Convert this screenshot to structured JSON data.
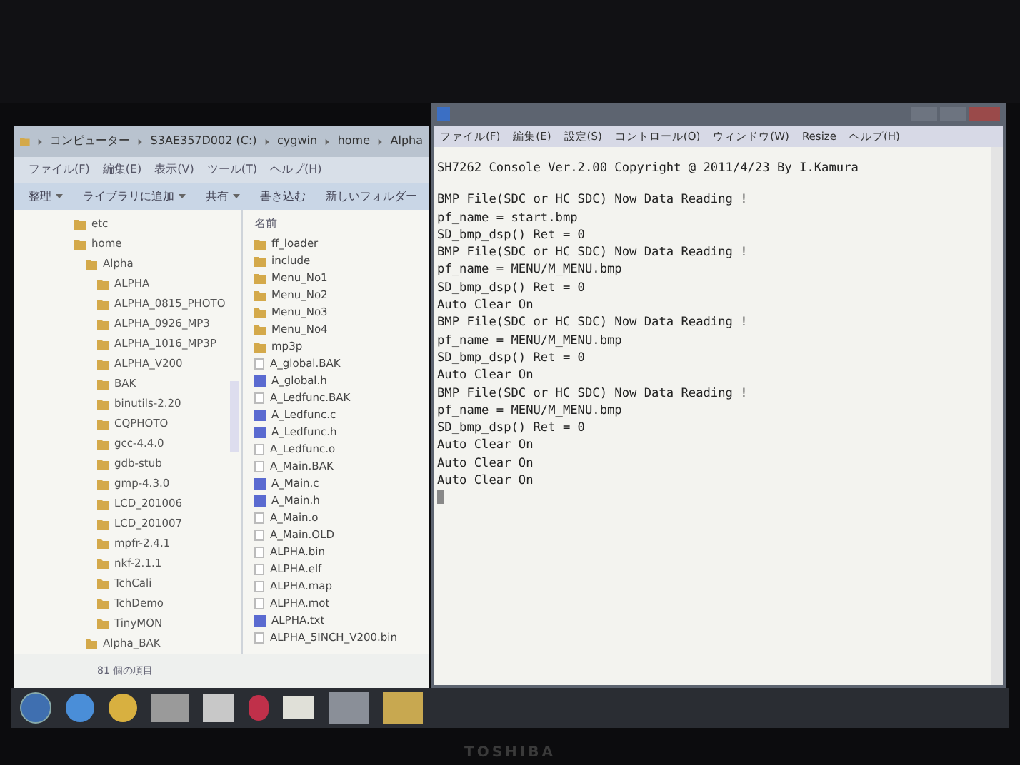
{
  "explorer": {
    "breadcrumb": [
      "コンピューター",
      "S3AE357D002 (C:)",
      "cygwin",
      "home",
      "Alpha"
    ],
    "menu": [
      "ファイル(F)",
      "編集(E)",
      "表示(V)",
      "ツール(T)",
      "ヘルプ(H)"
    ],
    "toolbar": [
      {
        "label": "整理",
        "dropdown": true
      },
      {
        "label": "ライブラリに追加",
        "dropdown": true
      },
      {
        "label": "共有",
        "dropdown": true
      },
      {
        "label": "書き込む",
        "dropdown": false
      },
      {
        "label": "新しいフォルダー",
        "dropdown": false
      }
    ],
    "tree": [
      {
        "label": "etc"
      },
      {
        "label": "home",
        "children": [
          {
            "label": "Alpha",
            "children": [
              {
                "label": "ALPHA"
              },
              {
                "label": "ALPHA_0815_PHOTO"
              },
              {
                "label": "ALPHA_0926_MP3"
              },
              {
                "label": "ALPHA_1016_MP3P"
              },
              {
                "label": "ALPHA_V200"
              },
              {
                "label": "BAK"
              },
              {
                "label": "binutils-2.20"
              },
              {
                "label": "CQPHOTO"
              },
              {
                "label": "gcc-4.4.0"
              },
              {
                "label": "gdb-stub"
              },
              {
                "label": "gmp-4.3.0"
              },
              {
                "label": "LCD_201006"
              },
              {
                "label": "LCD_201007"
              },
              {
                "label": "mpfr-2.4.1"
              },
              {
                "label": "nkf-2.1.1"
              },
              {
                "label": "TchCali"
              },
              {
                "label": "TchDemo"
              },
              {
                "label": "TinyMON"
              }
            ]
          },
          {
            "label": "Alpha_BAK"
          }
        ]
      }
    ],
    "column_header": "名前",
    "files": [
      {
        "name": "ff_loader",
        "kind": "folder"
      },
      {
        "name": "include",
        "kind": "folder"
      },
      {
        "name": "Menu_No1",
        "kind": "folder"
      },
      {
        "name": "Menu_No2",
        "kind": "folder"
      },
      {
        "name": "Menu_No3",
        "kind": "folder"
      },
      {
        "name": "Menu_No4",
        "kind": "folder"
      },
      {
        "name": "mp3p",
        "kind": "folder"
      },
      {
        "name": "A_global.BAK",
        "kind": "file"
      },
      {
        "name": "A_global.h",
        "kind": "source"
      },
      {
        "name": "A_Ledfunc.BAK",
        "kind": "file"
      },
      {
        "name": "A_Ledfunc.c",
        "kind": "source"
      },
      {
        "name": "A_Ledfunc.h",
        "kind": "source"
      },
      {
        "name": "A_Ledfunc.o",
        "kind": "file"
      },
      {
        "name": "A_Main.BAK",
        "kind": "file"
      },
      {
        "name": "A_Main.c",
        "kind": "source"
      },
      {
        "name": "A_Main.h",
        "kind": "source"
      },
      {
        "name": "A_Main.o",
        "kind": "file"
      },
      {
        "name": "A_Main.OLD",
        "kind": "file"
      },
      {
        "name": "ALPHA.bin",
        "kind": "file"
      },
      {
        "name": "ALPHA.elf",
        "kind": "file"
      },
      {
        "name": "ALPHA.map",
        "kind": "file"
      },
      {
        "name": "ALPHA.mot",
        "kind": "file"
      },
      {
        "name": "ALPHA.txt",
        "kind": "source"
      },
      {
        "name": "ALPHA_5INCH_V200.bin",
        "kind": "file"
      }
    ],
    "status": "81 個の項目"
  },
  "terminal": {
    "menu": [
      "ファイル(F)",
      "編集(E)",
      "設定(S)",
      "コントロール(O)",
      "ウィンドウ(W)",
      "Resize",
      "ヘルプ(H)"
    ],
    "paragraphs": [
      [
        "SH7262 Console Ver.2.00 Copyright @ 2011/4/23 By I.Kamura"
      ],
      [
        "BMP File(SDC or HC SDC) Now Data Reading !",
        "pf_name = start.bmp",
        "SD_bmp_dsp() Ret = 0",
        "BMP File(SDC or HC SDC) Now Data Reading !",
        "pf_name = MENU/M_MENU.bmp",
        "SD_bmp_dsp() Ret = 0",
        "Auto Clear On",
        "BMP File(SDC or HC SDC) Now Data Reading !",
        "pf_name = MENU/M_MENU.bmp",
        "SD_bmp_dsp() Ret = 0",
        "Auto Clear On",
        "BMP File(SDC or HC SDC) Now Data Reading !",
        "pf_name = MENU/M_MENU.bmp",
        "SD_bmp_dsp() Ret = 0",
        "Auto Clear On",
        "Auto Clear On",
        "Auto Clear On"
      ]
    ]
  },
  "bezel_brand": "TOSHIBA"
}
